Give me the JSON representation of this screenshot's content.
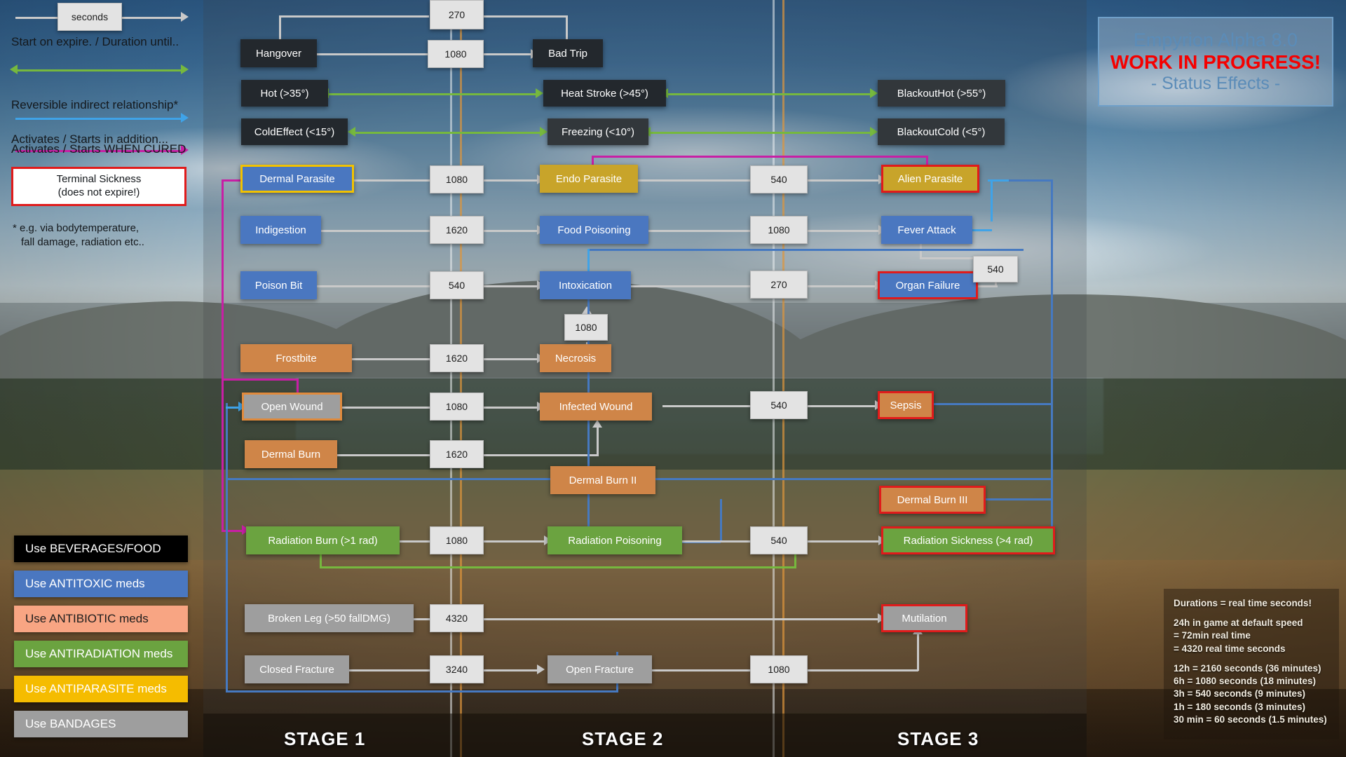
{
  "title_box": {
    "line1": "Empyrion Alpha 8.0",
    "line2": "WORK IN PROGRESS!",
    "line3": "- Status Effects -",
    "accent": "#5b8cb8",
    "warn": "#f50000"
  },
  "legend": {
    "seconds_chip": "seconds",
    "row1": "Start on expire. / Duration until..",
    "row2": "Reversible indirect relationship*",
    "row3": "Activates / Starts in addition...",
    "row4": "Activates / Starts WHEN CURED",
    "terminal_line1": "Terminal Sickness",
    "terminal_line2": "(does not expire!)",
    "footnote_line1": "* e.g. via bodytemperature,",
    "footnote_line2": "fall damage, radiation etc..",
    "colors": {
      "grey": "#c9c9c9",
      "green": "#76b83e",
      "blue": "#3fa3e8",
      "magenta": "#c81fa5",
      "terminal_border": "#e01b1b"
    },
    "swatches": [
      {
        "label": "Use BEVERAGES/FOOD",
        "bg": "#000000",
        "fg": "#ffffff"
      },
      {
        "label": "Use ANTITOXIC meds",
        "bg": "#4a77c0",
        "fg": "#ffffff"
      },
      {
        "label": "Use ANTIBIOTIC meds",
        "bg": "#f8a583",
        "fg": "#1c1c1c"
      },
      {
        "label": "Use ANTIRADIATION meds",
        "bg": "#6ba340",
        "fg": "#ffffff"
      },
      {
        "label": "Use ANTIPARASITE meds",
        "bg": "#f5bc00",
        "fg": "#ffffff"
      },
      {
        "label": "Use BANDAGES",
        "bg": "#9e9e9e",
        "fg": "#ffffff"
      }
    ]
  },
  "stages": [
    {
      "label": "STAGE 1"
    },
    {
      "label": "STAGE 2"
    },
    {
      "label": "STAGE 3"
    }
  ],
  "nodes": [
    {
      "id": "hangover",
      "label": "Hangover",
      "style": "n-dark"
    },
    {
      "id": "bad_trip",
      "label": "Bad Trip",
      "style": "n-dark"
    },
    {
      "id": "hot",
      "label": "Hot (>35°)",
      "style": "n-dark"
    },
    {
      "id": "heat_stroke",
      "label": "Heat Stroke (>45°)",
      "style": "n-dark"
    },
    {
      "id": "blackout_hot",
      "label": "BlackoutHot (>55°)",
      "style": "n-dark2"
    },
    {
      "id": "cold_effect",
      "label": "ColdEffect (<15°)",
      "style": "n-dark"
    },
    {
      "id": "freezing",
      "label": "Freezing (<10°)",
      "style": "n-dark2"
    },
    {
      "id": "blackout_cold",
      "label": "BlackoutCold (<5°)",
      "style": "n-dark2"
    },
    {
      "id": "dermal_parasite",
      "label": "Dermal Parasite",
      "style": "n-blue",
      "border": "b-yellow"
    },
    {
      "id": "endo_parasite",
      "label": "Endo Parasite",
      "style": "n-gold"
    },
    {
      "id": "alien_parasite",
      "label": "Alien Parasite",
      "style": "n-gold",
      "border": "b-red"
    },
    {
      "id": "indigestion",
      "label": "Indigestion",
      "style": "n-blue"
    },
    {
      "id": "food_poisoning",
      "label": "Food Poisoning",
      "style": "n-blue"
    },
    {
      "id": "fever_attack",
      "label": "Fever Attack",
      "style": "n-blue"
    },
    {
      "id": "poison_bit",
      "label": "Poison Bit",
      "style": "n-blue"
    },
    {
      "id": "intoxication",
      "label": "Intoxication",
      "style": "n-blue"
    },
    {
      "id": "organ_failure",
      "label": "Organ Failure",
      "style": "n-blue",
      "border": "b-red"
    },
    {
      "id": "frostbite",
      "label": "Frostbite",
      "style": "n-orange"
    },
    {
      "id": "necrosis",
      "label": "Necrosis",
      "style": "n-orange"
    },
    {
      "id": "open_wound",
      "label": "Open Wound",
      "style": "n-grey",
      "border": "b-orange"
    },
    {
      "id": "infected_wound",
      "label": "Infected Wound",
      "style": "n-orange"
    },
    {
      "id": "sepsis",
      "label": "Sepsis",
      "style": "n-orange",
      "border": "b-red"
    },
    {
      "id": "dermal_burn",
      "label": "Dermal Burn",
      "style": "n-orange"
    },
    {
      "id": "dermal_burn_2",
      "label": "Dermal Burn II",
      "style": "n-orange"
    },
    {
      "id": "dermal_burn_3",
      "label": "Dermal Burn III",
      "style": "n-orange",
      "border": "b-red"
    },
    {
      "id": "radiation_burn",
      "label": "Radiation Burn (>1 rad)",
      "style": "n-green"
    },
    {
      "id": "radiation_pois",
      "label": "Radiation Poisoning",
      "style": "n-green"
    },
    {
      "id": "radiation_sick",
      "label": "Radiation Sickness (>4 rad)",
      "style": "n-green",
      "border": "b-red"
    },
    {
      "id": "broken_leg",
      "label": "Broken Leg (>50 fallDMG)",
      "style": "n-grey"
    },
    {
      "id": "mutilation",
      "label": "Mutilation",
      "style": "n-grey",
      "border": "b-red"
    },
    {
      "id": "closed_fracture",
      "label": "Closed Fracture",
      "style": "n-grey"
    },
    {
      "id": "open_fracture",
      "label": "Open Fracture",
      "style": "n-grey"
    }
  ],
  "durations": [
    {
      "id": "d_270_top",
      "value": "270"
    },
    {
      "id": "d_1080_bt",
      "value": "1080"
    },
    {
      "id": "d_1080_par",
      "value": "1080"
    },
    {
      "id": "d_540_par",
      "value": "540"
    },
    {
      "id": "d_1620_ind",
      "value": "1620"
    },
    {
      "id": "d_1080_fp",
      "value": "1080"
    },
    {
      "id": "d_540_pb",
      "value": "540"
    },
    {
      "id": "d_270_int",
      "value": "270"
    },
    {
      "id": "d_540_fev",
      "value": "540"
    },
    {
      "id": "d_1080_intox",
      "value": "1080"
    },
    {
      "id": "d_1620_fb",
      "value": "1620"
    },
    {
      "id": "d_1080_ow",
      "value": "1080"
    },
    {
      "id": "d_540_iw",
      "value": "540"
    },
    {
      "id": "d_1620_db",
      "value": "1620"
    },
    {
      "id": "d_1080_rb",
      "value": "1080"
    },
    {
      "id": "d_540_rp",
      "value": "540"
    },
    {
      "id": "d_4320_bl",
      "value": "4320"
    },
    {
      "id": "d_3240_cf",
      "value": "3240"
    },
    {
      "id": "d_1080_of",
      "value": "1080"
    }
  ],
  "info_box": {
    "l1": "Durations = real time seconds!",
    "l2": "24h in game at default speed",
    "l3": " = 72min real time",
    "l4": "= 4320 real time seconds",
    "l5": "12h = 2160 seconds (36 minutes)",
    "l6": "6h = 1080 seconds (18 minutes)",
    "l7": "3h = 540 seconds (9 minutes)",
    "l8": "1h = 180 seconds (3 minutes)",
    "l9": "30 min = 60 seconds (1.5 minutes)"
  }
}
